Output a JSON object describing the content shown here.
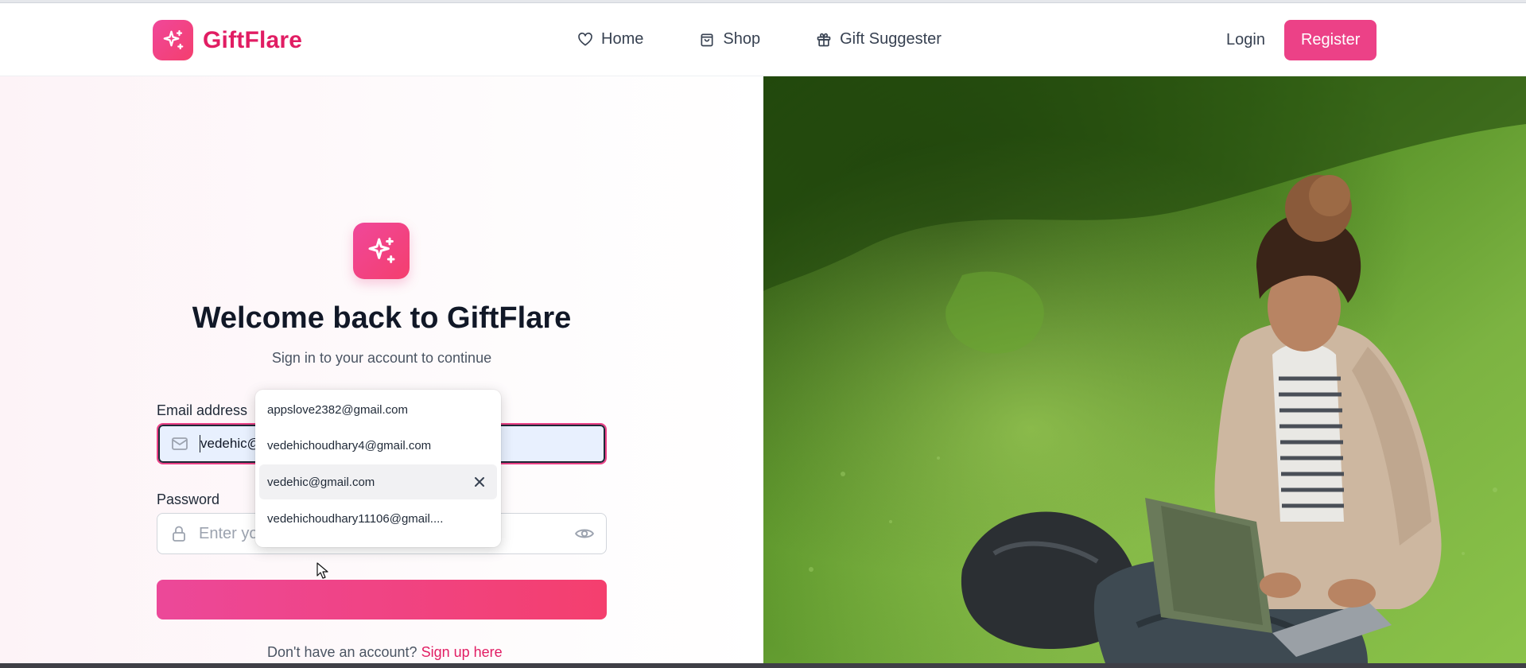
{
  "brand": {
    "name": "GiftFlare",
    "logo_icon": "sparkles-icon",
    "accent": "#ec4187"
  },
  "nav": {
    "items": [
      {
        "label": "Home",
        "icon": "heart-icon"
      },
      {
        "label": "Shop",
        "icon": "shopping-bag-icon"
      },
      {
        "label": "Gift Suggester",
        "icon": "gift-icon"
      }
    ]
  },
  "auth": {
    "login_label": "Login",
    "register_label": "Register"
  },
  "form": {
    "title": "Welcome back to GiftFlare",
    "subtitle": "Sign in to your account to continue",
    "email_label": "Email address",
    "email_value": "vedehic@gmail.com",
    "password_label": "Password",
    "password_placeholder": "Enter yo",
    "signup_prompt": "Don't have an account?",
    "signup_link": "Sign up here"
  },
  "autofill": {
    "items": [
      {
        "label": "appslove2382@gmail.com"
      },
      {
        "label": "vedehichoudhary4@gmail.com"
      },
      {
        "label": "vedehic@gmail.com",
        "highlighted": true
      },
      {
        "label": "vedehichoudhary11106@gmail...."
      }
    ]
  },
  "colors": {
    "brand_pink": "#ec4187",
    "brand_text": "#e11d63",
    "autofill_bg": "#e8f0fe"
  }
}
